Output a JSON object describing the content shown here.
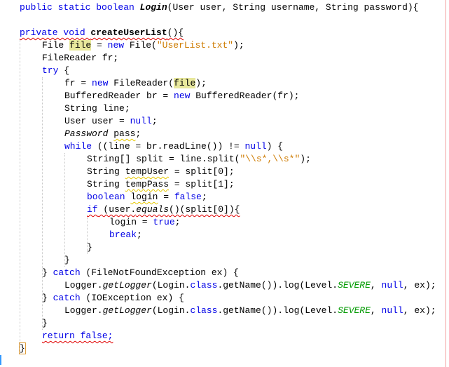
{
  "editor": {
    "language": "java",
    "lines": [
      {
        "indent": 0,
        "tokens": [
          {
            "t": "public static boolean ",
            "c": "kw"
          },
          {
            "t": "Login",
            "c": "it bold"
          },
          {
            "t": "(User user, String username, String password){",
            "c": ""
          }
        ]
      },
      {
        "indent": 0,
        "tokens": []
      },
      {
        "indent": 0,
        "tokens": [
          {
            "t": "private void ",
            "c": "kw err"
          },
          {
            "t": "createUserList",
            "c": "bold err"
          },
          {
            "t": "(){",
            "c": "err"
          }
        ]
      },
      {
        "indent": 1,
        "tokens": [
          {
            "t": "File ",
            "c": ""
          },
          {
            "t": "file",
            "c": "hl"
          },
          {
            "t": " = ",
            "c": ""
          },
          {
            "t": "new",
            "c": "kw"
          },
          {
            "t": " File(",
            "c": ""
          },
          {
            "t": "\"UserList.txt\"",
            "c": "str"
          },
          {
            "t": ");",
            "c": ""
          }
        ]
      },
      {
        "indent": 1,
        "tokens": [
          {
            "t": "FileReader fr;",
            "c": ""
          }
        ]
      },
      {
        "indent": 1,
        "tokens": [
          {
            "t": "try",
            "c": "kw"
          },
          {
            "t": " {",
            "c": ""
          }
        ]
      },
      {
        "indent": 2,
        "tokens": [
          {
            "t": "fr = ",
            "c": ""
          },
          {
            "t": "new",
            "c": "kw"
          },
          {
            "t": " FileReader(",
            "c": ""
          },
          {
            "t": "file",
            "c": "hl"
          },
          {
            "t": ");",
            "c": ""
          }
        ]
      },
      {
        "indent": 2,
        "tokens": [
          {
            "t": "BufferedReader br = ",
            "c": ""
          },
          {
            "t": "new",
            "c": "kw"
          },
          {
            "t": " BufferedReader(fr);",
            "c": ""
          }
        ]
      },
      {
        "indent": 2,
        "tokens": [
          {
            "t": "String line;",
            "c": ""
          }
        ]
      },
      {
        "indent": 2,
        "tokens": [
          {
            "t": "User user = ",
            "c": ""
          },
          {
            "t": "null",
            "c": "kw"
          },
          {
            "t": ";",
            "c": ""
          }
        ]
      },
      {
        "indent": 2,
        "tokens": [
          {
            "t": "Password",
            "c": "it"
          },
          {
            "t": " ",
            "c": ""
          },
          {
            "t": "pass",
            "c": "warn"
          },
          {
            "t": ";",
            "c": ""
          }
        ]
      },
      {
        "indent": 2,
        "tokens": [
          {
            "t": "while",
            "c": "kw"
          },
          {
            "t": " ((line = br.readLine()) != ",
            "c": ""
          },
          {
            "t": "null",
            "c": "kw"
          },
          {
            "t": ") {",
            "c": ""
          }
        ]
      },
      {
        "indent": 3,
        "tokens": [
          {
            "t": "String[] split = line.split(",
            "c": ""
          },
          {
            "t": "\"\\\\s*,\\\\s*\"",
            "c": "str"
          },
          {
            "t": ");",
            "c": ""
          }
        ]
      },
      {
        "indent": 3,
        "tokens": [
          {
            "t": "String ",
            "c": ""
          },
          {
            "t": "tempUser",
            "c": "warn"
          },
          {
            "t": " = split[0];",
            "c": ""
          }
        ]
      },
      {
        "indent": 3,
        "tokens": [
          {
            "t": "String ",
            "c": ""
          },
          {
            "t": "tempPass",
            "c": "warn"
          },
          {
            "t": " = split[1];",
            "c": ""
          }
        ]
      },
      {
        "indent": 3,
        "tokens": [
          {
            "t": "boolean",
            "c": "kw"
          },
          {
            "t": " ",
            "c": ""
          },
          {
            "t": "login",
            "c": "warn"
          },
          {
            "t": " = ",
            "c": ""
          },
          {
            "t": "false",
            "c": "kw"
          },
          {
            "t": ";",
            "c": ""
          }
        ]
      },
      {
        "indent": 3,
        "tokens": [
          {
            "t": "if",
            "c": "kw err"
          },
          {
            "t": " (user.",
            "c": "err"
          },
          {
            "t": "equals",
            "c": "it err"
          },
          {
            "t": "()(split[0]){",
            "c": "err"
          }
        ]
      },
      {
        "indent": 4,
        "tokens": [
          {
            "t": "login = ",
            "c": ""
          },
          {
            "t": "true",
            "c": "kw"
          },
          {
            "t": ";",
            "c": ""
          }
        ]
      },
      {
        "indent": 4,
        "tokens": [
          {
            "t": "break",
            "c": "kw"
          },
          {
            "t": ";",
            "c": ""
          }
        ]
      },
      {
        "indent": 3,
        "tokens": [
          {
            "t": "}",
            "c": ""
          }
        ]
      },
      {
        "indent": 2,
        "tokens": [
          {
            "t": "}",
            "c": ""
          }
        ]
      },
      {
        "indent": 1,
        "tokens": [
          {
            "t": "} ",
            "c": ""
          },
          {
            "t": "catch",
            "c": "kw"
          },
          {
            "t": " (FileNotFoundException ex) {",
            "c": ""
          }
        ]
      },
      {
        "indent": 2,
        "tokens": [
          {
            "t": "Logger.",
            "c": ""
          },
          {
            "t": "getLogger",
            "c": "it"
          },
          {
            "t": "(Login.",
            "c": ""
          },
          {
            "t": "class",
            "c": "kw"
          },
          {
            "t": ".getName()).log(Level.",
            "c": ""
          },
          {
            "t": "SEVERE",
            "c": "static-field"
          },
          {
            "t": ", ",
            "c": ""
          },
          {
            "t": "null",
            "c": "kw"
          },
          {
            "t": ", ex);",
            "c": ""
          }
        ]
      },
      {
        "indent": 1,
        "tokens": [
          {
            "t": "} ",
            "c": ""
          },
          {
            "t": "catch",
            "c": "kw"
          },
          {
            "t": " (IOException ex) {",
            "c": ""
          }
        ]
      },
      {
        "indent": 2,
        "tokens": [
          {
            "t": "Logger.",
            "c": ""
          },
          {
            "t": "getLogger",
            "c": "it"
          },
          {
            "t": "(Login.",
            "c": ""
          },
          {
            "t": "class",
            "c": "kw"
          },
          {
            "t": ".getName()).log(Level.",
            "c": ""
          },
          {
            "t": "SEVERE",
            "c": "static-field"
          },
          {
            "t": ", ",
            "c": ""
          },
          {
            "t": "null",
            "c": "kw"
          },
          {
            "t": ", ex);",
            "c": ""
          }
        ]
      },
      {
        "indent": 1,
        "tokens": [
          {
            "t": "}",
            "c": ""
          }
        ]
      },
      {
        "indent": 1,
        "tokens": [
          {
            "t": "return false;",
            "c": "kw err"
          }
        ]
      },
      {
        "indent": 0,
        "tokens": [
          {
            "t": "}",
            "c": "brace-match"
          }
        ]
      }
    ]
  }
}
